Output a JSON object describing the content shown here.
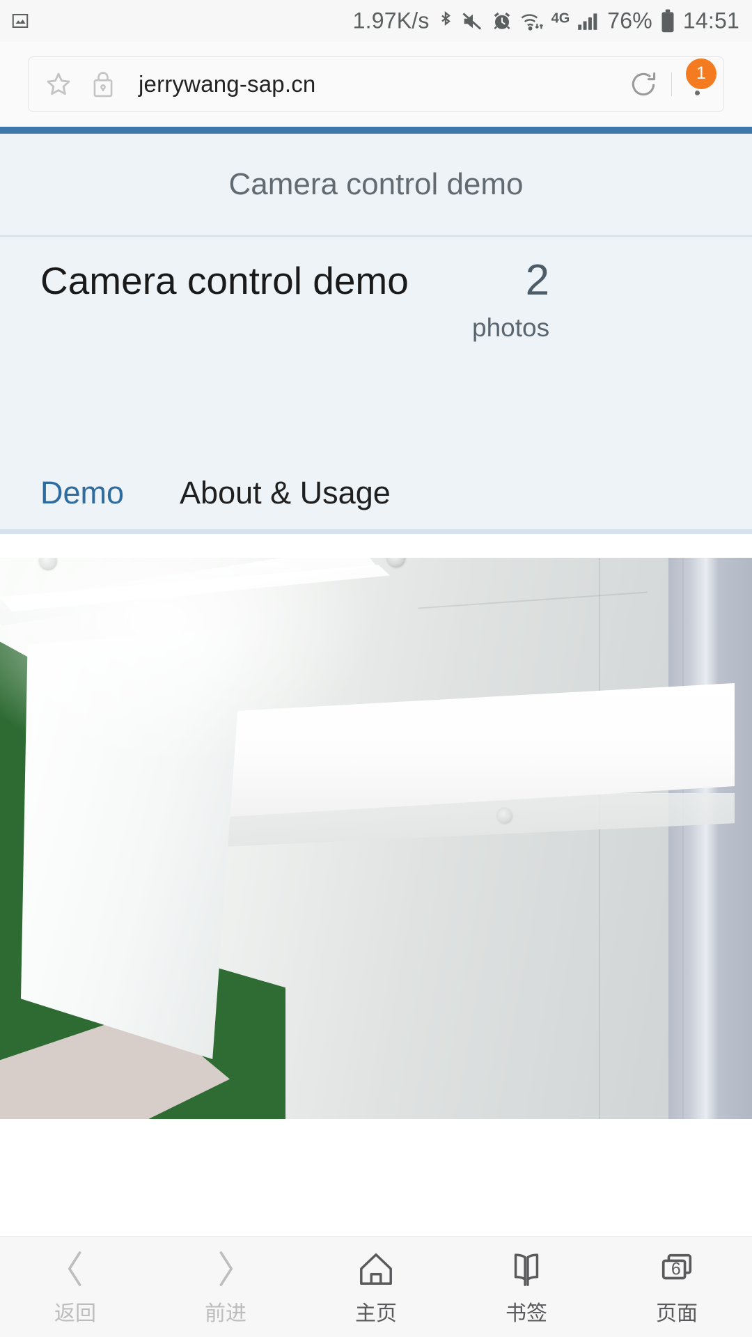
{
  "statusbar": {
    "photo_icon": "image-icon",
    "network_speed": "1.97K/s",
    "bluetooth_icon": "bluetooth-icon",
    "mute_icon": "volume-mute-icon",
    "alarm_icon": "alarm-clock-icon",
    "wifi_icon": "wifi-icon",
    "network_type": "4G",
    "signal_icon": "cellular-signal-icon",
    "battery_percent": "76%",
    "battery_icon": "battery-icon",
    "time": "14:51"
  },
  "browser": {
    "star_icon": "star-icon",
    "lock_icon": "lock-icon",
    "url": "jerrywang-sap.cn",
    "reload_icon": "reload-icon",
    "menu_icon": "overflow-menu-icon",
    "menu_badge": "1",
    "badge_color": "#f47b20"
  },
  "page": {
    "header_title": "Camera control demo",
    "accent_rule_color": "#3e78ab",
    "background_color": "#eef3f7",
    "object": {
      "title": "Camera control demo",
      "count": "2",
      "count_label": "photos"
    },
    "tabs": [
      {
        "label": "Demo",
        "active": true,
        "color": "#2e6b9e"
      },
      {
        "label": "About & Usage",
        "active": false,
        "color": "#1f1f1f"
      }
    ],
    "photo": {
      "alt": "camera-preview-photo",
      "description": "Photo of a white shelf board against a white and green wall"
    }
  },
  "bottomnav": [
    {
      "label": "返回",
      "icon": "chevron-left-icon",
      "disabled": true
    },
    {
      "label": "前进",
      "icon": "chevron-right-icon",
      "disabled": true
    },
    {
      "label": "主页",
      "icon": "home-icon",
      "disabled": false
    },
    {
      "label": "书签",
      "icon": "bookmark-icon",
      "disabled": false
    },
    {
      "label": "页面",
      "icon": "tabs-icon",
      "disabled": false,
      "count": "6"
    }
  ]
}
